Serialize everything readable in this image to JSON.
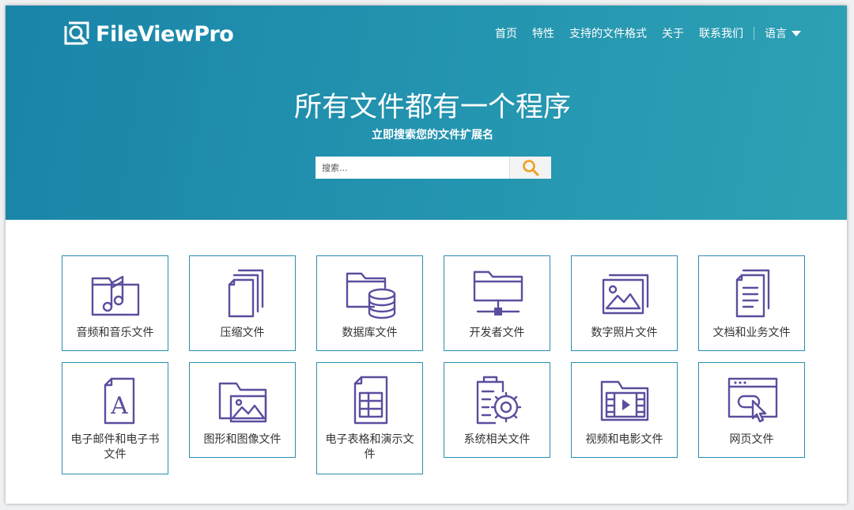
{
  "header": {
    "logo_text": "FileViewPro",
    "nav": [
      "首页",
      "特性",
      "支持的文件格式",
      "关于",
      "联系我们"
    ],
    "language_label": "语言"
  },
  "hero": {
    "title": "所有文件都有一个程序",
    "subtitle": "立即搜索您的文件扩展名",
    "search_placeholder": "搜索..."
  },
  "categories": [
    {
      "label": "音频和音乐文件",
      "icon": "music-folder-icon"
    },
    {
      "label": "压缩文件",
      "icon": "stacked-files-icon"
    },
    {
      "label": "数据库文件",
      "icon": "database-folder-icon"
    },
    {
      "label": "开发者文件",
      "icon": "network-folder-icon"
    },
    {
      "label": "数字照片文件",
      "icon": "photos-icon"
    },
    {
      "label": "文档和业务文件",
      "icon": "document-icon"
    },
    {
      "label": "电子邮件和电子书文件",
      "icon": "ebook-icon"
    },
    {
      "label": "图形和图像文件",
      "icon": "image-folder-icon"
    },
    {
      "label": "电子表格和演示文件",
      "icon": "spreadsheet-icon"
    },
    {
      "label": "系统相关文件",
      "icon": "system-gear-icon"
    },
    {
      "label": "视频和电影文件",
      "icon": "video-folder-icon"
    },
    {
      "label": "网页文件",
      "icon": "webpage-icon"
    }
  ],
  "colors": {
    "hero_start": "#1a84a8",
    "hero_end": "#2ea1b4",
    "card_border": "#2a8fb0",
    "icon": "#5a4e9e",
    "search_icon": "#f0a020"
  }
}
